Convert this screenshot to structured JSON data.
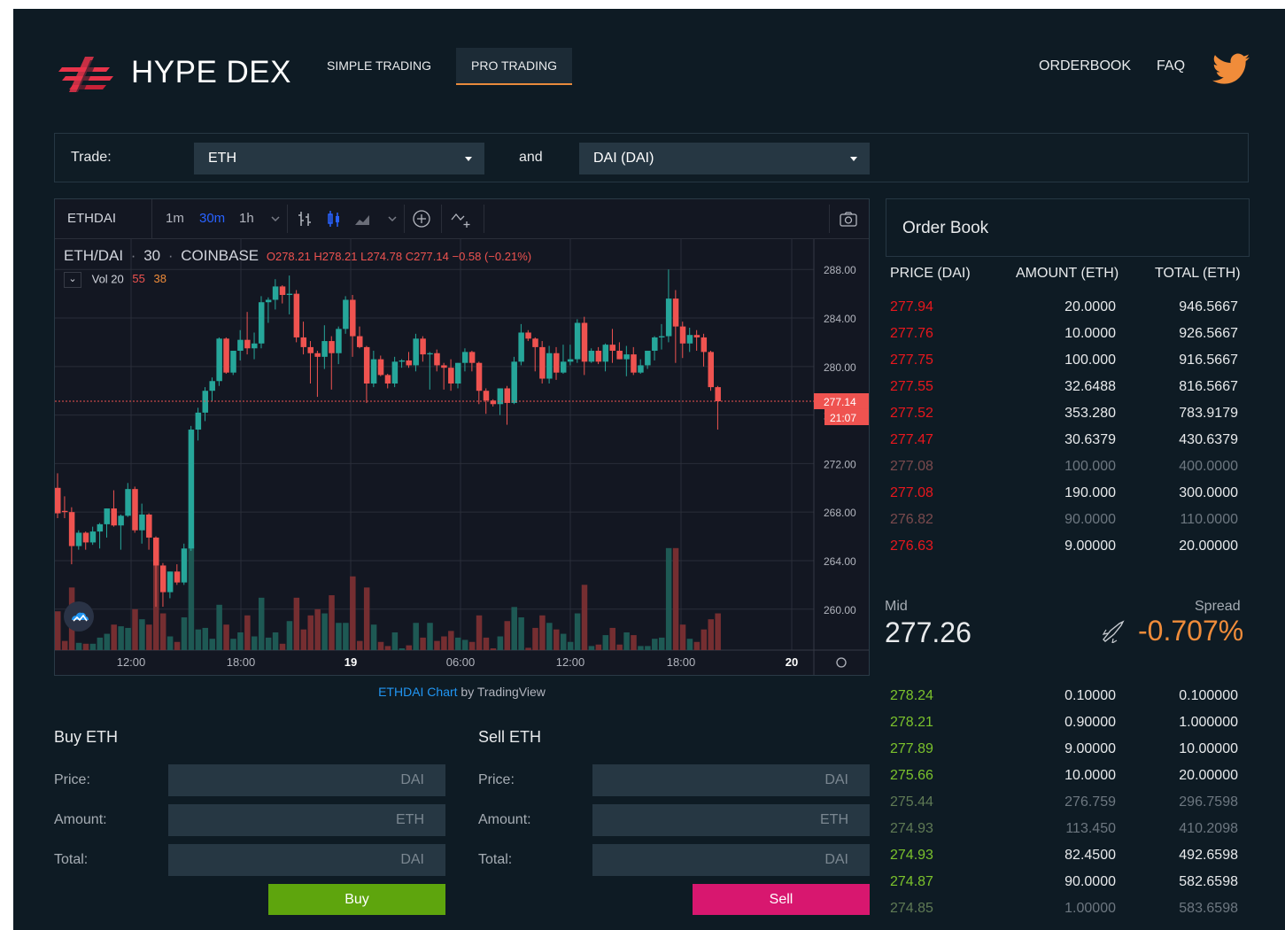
{
  "header": {
    "brand": "HYPE DEX",
    "tabs": [
      {
        "label": "SIMPLE TRADING",
        "active": false
      },
      {
        "label": "PRO TRADING",
        "active": true
      }
    ],
    "links": {
      "orderbook": "ORDERBOOK",
      "faq": "FAQ"
    },
    "accent_color": "#e8334a"
  },
  "trade_bar": {
    "label": "Trade:",
    "base_token": "ETH",
    "and_label": "and",
    "quote_token": "DAI (DAI)"
  },
  "chart": {
    "toolbar": {
      "symbol": "ETHDAI",
      "intervals": [
        "1m",
        "30m",
        "1h"
      ],
      "active_interval": "30m"
    },
    "legend": {
      "pair": "ETH/DAI",
      "interval": "30",
      "exchange": "COINBASE",
      "ohlc": "O278.21  H278.21  L274.78  C277.14  −0.58 (−0.21%)"
    },
    "volume_legend": {
      "label": "Vol 20",
      "v1": "55",
      "v2": "38"
    },
    "credit": {
      "link": "ETHDAI Chart",
      "suffix": " by TradingView"
    }
  },
  "chart_data": {
    "type": "candlestick",
    "title": "ETH/DAI",
    "y_ticks": [
      "288.00",
      "284.00",
      "280.00",
      "276.00",
      "272.00",
      "268.00",
      "264.00",
      "260.00"
    ],
    "ylim": [
      257.5,
      290.5
    ],
    "x_ticks": [
      "12:00",
      "18:00",
      "19",
      "06:00",
      "12:00",
      "18:00",
      "20"
    ],
    "current_price": "277.14",
    "countdown": "21:07",
    "up_color": "#26a69a",
    "down_color": "#ef5350",
    "candles": [
      {
        "o": 270.0,
        "h": 271.2,
        "l": 267.5,
        "c": 267.9
      },
      {
        "o": 268.1,
        "h": 269.3,
        "l": 267.5,
        "c": 268.0
      },
      {
        "o": 268.0,
        "h": 268.4,
        "l": 263.7,
        "c": 265.2
      },
      {
        "o": 265.2,
        "h": 266.5,
        "l": 264.9,
        "c": 266.3
      },
      {
        "o": 266.3,
        "h": 266.4,
        "l": 264.9,
        "c": 265.5
      },
      {
        "o": 265.5,
        "h": 266.8,
        "l": 265.3,
        "c": 266.4
      },
      {
        "o": 266.4,
        "h": 267.1,
        "l": 265.0,
        "c": 267.0
      },
      {
        "o": 267.0,
        "h": 268.3,
        "l": 265.9,
        "c": 268.3
      },
      {
        "o": 268.3,
        "h": 269.8,
        "l": 266.8,
        "c": 266.9
      },
      {
        "o": 266.9,
        "h": 267.8,
        "l": 264.9,
        "c": 267.7
      },
      {
        "o": 267.7,
        "h": 270.4,
        "l": 267.6,
        "c": 269.9
      },
      {
        "o": 269.9,
        "h": 270.1,
        "l": 266.3,
        "c": 266.5
      },
      {
        "o": 266.5,
        "h": 268.7,
        "l": 265.4,
        "c": 267.8
      },
      {
        "o": 267.8,
        "h": 267.9,
        "l": 264.9,
        "c": 265.9
      },
      {
        "o": 265.9,
        "h": 266.0,
        "l": 260.2,
        "c": 263.6
      },
      {
        "o": 263.6,
        "h": 263.8,
        "l": 260.2,
        "c": 261.4
      },
      {
        "o": 261.4,
        "h": 263.1,
        "l": 260.9,
        "c": 263.1
      },
      {
        "o": 263.1,
        "h": 263.7,
        "l": 262.0,
        "c": 262.2
      },
      {
        "o": 262.2,
        "h": 265.4,
        "l": 262.0,
        "c": 265.0
      },
      {
        "o": 265.0,
        "h": 275.1,
        "l": 264.8,
        "c": 274.8
      },
      {
        "o": 274.8,
        "h": 276.6,
        "l": 273.9,
        "c": 276.2
      },
      {
        "o": 276.2,
        "h": 278.3,
        "l": 275.5,
        "c": 278.0
      },
      {
        "o": 278.0,
        "h": 279.1,
        "l": 277.1,
        "c": 278.8
      },
      {
        "o": 278.8,
        "h": 282.4,
        "l": 278.4,
        "c": 282.3
      },
      {
        "o": 282.3,
        "h": 282.4,
        "l": 279.4,
        "c": 279.5
      },
      {
        "o": 279.5,
        "h": 281.3,
        "l": 279.3,
        "c": 281.3
      },
      {
        "o": 281.3,
        "h": 283.0,
        "l": 280.5,
        "c": 282.2
      },
      {
        "o": 282.2,
        "h": 284.5,
        "l": 281.0,
        "c": 281.5
      },
      {
        "o": 281.5,
        "h": 282.8,
        "l": 280.6,
        "c": 281.9
      },
      {
        "o": 281.9,
        "h": 285.8,
        "l": 281.5,
        "c": 285.3
      },
      {
        "o": 285.3,
        "h": 285.7,
        "l": 283.6,
        "c": 285.5
      },
      {
        "o": 285.5,
        "h": 287.2,
        "l": 284.7,
        "c": 286.6
      },
      {
        "o": 286.6,
        "h": 286.7,
        "l": 285.2,
        "c": 285.9
      },
      {
        "o": 285.9,
        "h": 287.5,
        "l": 284.3,
        "c": 286.0
      },
      {
        "o": 286.0,
        "h": 286.3,
        "l": 282.0,
        "c": 282.4
      },
      {
        "o": 282.4,
        "h": 283.7,
        "l": 281.0,
        "c": 281.6
      },
      {
        "o": 281.6,
        "h": 282.1,
        "l": 278.6,
        "c": 281.1
      },
      {
        "o": 281.1,
        "h": 281.3,
        "l": 277.5,
        "c": 280.8
      },
      {
        "o": 280.8,
        "h": 283.4,
        "l": 279.8,
        "c": 282.1
      },
      {
        "o": 282.1,
        "h": 282.5,
        "l": 278.1,
        "c": 281.1
      },
      {
        "o": 281.1,
        "h": 283.3,
        "l": 280.2,
        "c": 283.1
      },
      {
        "o": 283.1,
        "h": 285.8,
        "l": 282.7,
        "c": 285.5
      },
      {
        "o": 285.5,
        "h": 285.9,
        "l": 280.8,
        "c": 282.5
      },
      {
        "o": 282.5,
        "h": 283.3,
        "l": 281.5,
        "c": 281.6
      },
      {
        "o": 281.6,
        "h": 281.7,
        "l": 277.0,
        "c": 278.6
      },
      {
        "o": 278.6,
        "h": 281.3,
        "l": 278.3,
        "c": 280.6
      },
      {
        "o": 280.6,
        "h": 280.9,
        "l": 279.2,
        "c": 279.3
      },
      {
        "o": 279.3,
        "h": 279.4,
        "l": 278.2,
        "c": 278.6
      },
      {
        "o": 278.6,
        "h": 280.8,
        "l": 278.3,
        "c": 280.4
      },
      {
        "o": 280.4,
        "h": 280.6,
        "l": 279.9,
        "c": 280.5
      },
      {
        "o": 280.5,
        "h": 281.2,
        "l": 279.9,
        "c": 280.1
      },
      {
        "o": 280.1,
        "h": 282.7,
        "l": 279.6,
        "c": 282.3
      },
      {
        "o": 282.3,
        "h": 282.5,
        "l": 280.4,
        "c": 281.0
      },
      {
        "o": 281.0,
        "h": 281.2,
        "l": 278.1,
        "c": 281.1
      },
      {
        "o": 281.1,
        "h": 281.4,
        "l": 279.6,
        "c": 280.1
      },
      {
        "o": 280.1,
        "h": 280.3,
        "l": 278.1,
        "c": 279.9
      },
      {
        "o": 279.9,
        "h": 280.6,
        "l": 278.0,
        "c": 278.6
      },
      {
        "o": 278.6,
        "h": 280.3,
        "l": 278.2,
        "c": 280.3
      },
      {
        "o": 280.3,
        "h": 281.5,
        "l": 279.6,
        "c": 281.2
      },
      {
        "o": 281.2,
        "h": 281.3,
        "l": 279.6,
        "c": 280.3
      },
      {
        "o": 280.3,
        "h": 280.4,
        "l": 276.9,
        "c": 278.0
      },
      {
        "o": 278.0,
        "h": 278.2,
        "l": 276.1,
        "c": 277.2
      },
      {
        "o": 277.2,
        "h": 277.3,
        "l": 276.7,
        "c": 276.9
      },
      {
        "o": 276.9,
        "h": 278.2,
        "l": 276.0,
        "c": 278.2
      },
      {
        "o": 278.2,
        "h": 278.4,
        "l": 275.2,
        "c": 277.0
      },
      {
        "o": 277.0,
        "h": 280.8,
        "l": 276.9,
        "c": 280.4
      },
      {
        "o": 280.4,
        "h": 283.5,
        "l": 280.1,
        "c": 282.8
      },
      {
        "o": 282.8,
        "h": 283.0,
        "l": 282.1,
        "c": 282.3
      },
      {
        "o": 282.3,
        "h": 282.4,
        "l": 279.6,
        "c": 281.6
      },
      {
        "o": 281.6,
        "h": 282.1,
        "l": 278.6,
        "c": 279.0
      },
      {
        "o": 279.0,
        "h": 281.7,
        "l": 278.6,
        "c": 281.1
      },
      {
        "o": 281.1,
        "h": 281.6,
        "l": 278.9,
        "c": 279.5
      },
      {
        "o": 279.5,
        "h": 281.8,
        "l": 279.4,
        "c": 280.4
      },
      {
        "o": 280.4,
        "h": 281.8,
        "l": 280.1,
        "c": 280.6
      },
      {
        "o": 280.6,
        "h": 283.9,
        "l": 280.3,
        "c": 283.6
      },
      {
        "o": 283.6,
        "h": 284.1,
        "l": 279.3,
        "c": 280.4
      },
      {
        "o": 280.4,
        "h": 281.5,
        "l": 280.3,
        "c": 281.3
      },
      {
        "o": 281.3,
        "h": 281.6,
        "l": 280.2,
        "c": 280.4
      },
      {
        "o": 280.4,
        "h": 281.9,
        "l": 279.6,
        "c": 281.8
      },
      {
        "o": 281.8,
        "h": 283.1,
        "l": 280.3,
        "c": 281.3
      },
      {
        "o": 281.3,
        "h": 282.0,
        "l": 280.6,
        "c": 280.6
      },
      {
        "o": 280.6,
        "h": 281.7,
        "l": 279.2,
        "c": 281.0
      },
      {
        "o": 281.0,
        "h": 281.6,
        "l": 279.3,
        "c": 279.5
      },
      {
        "o": 279.5,
        "h": 280.6,
        "l": 279.4,
        "c": 280.1
      },
      {
        "o": 280.1,
        "h": 281.0,
        "l": 279.8,
        "c": 281.3
      },
      {
        "o": 281.3,
        "h": 282.5,
        "l": 280.5,
        "c": 282.4
      },
      {
        "o": 282.4,
        "h": 283.5,
        "l": 281.4,
        "c": 282.5
      },
      {
        "o": 282.5,
        "h": 288.0,
        "l": 282.0,
        "c": 285.6
      },
      {
        "o": 285.6,
        "h": 286.3,
        "l": 280.3,
        "c": 283.3
      },
      {
        "o": 283.3,
        "h": 283.7,
        "l": 280.7,
        "c": 281.9
      },
      {
        "o": 281.9,
        "h": 283.2,
        "l": 281.2,
        "c": 282.6
      },
      {
        "o": 282.6,
        "h": 283.0,
        "l": 281.3,
        "c": 282.4
      },
      {
        "o": 282.4,
        "h": 282.7,
        "l": 280.0,
        "c": 281.2
      },
      {
        "o": 281.2,
        "h": 281.3,
        "l": 278.0,
        "c": 278.3
      },
      {
        "o": 278.3,
        "h": 278.4,
        "l": 274.8,
        "c": 277.14
      }
    ],
    "volume_peaks_note": ""
  },
  "buy_form": {
    "title": "Buy ETH",
    "price_label": "Price:",
    "price_unit": "DAI",
    "amount_label": "Amount:",
    "amount_unit": "ETH",
    "total_label": "Total:",
    "total_unit": "DAI",
    "button": "Buy"
  },
  "sell_form": {
    "title": "Sell ETH",
    "price_label": "Price:",
    "price_unit": "DAI",
    "amount_label": "Amount:",
    "amount_unit": "ETH",
    "total_label": "Total:",
    "total_unit": "DAI",
    "button": "Sell"
  },
  "order_book": {
    "title": "Order Book",
    "columns": [
      "PRICE (DAI)",
      "AMOUNT (ETH)",
      "TOTAL (ETH)"
    ],
    "asks": [
      {
        "price": "277.94",
        "amount": "20.0000",
        "total": "946.5667",
        "dim": false
      },
      {
        "price": "277.76",
        "amount": "10.0000",
        "total": "926.5667",
        "dim": false
      },
      {
        "price": "277.75",
        "amount": "100.000",
        "total": "916.5667",
        "dim": false
      },
      {
        "price": "277.55",
        "amount": "32.6488",
        "total": "816.5667",
        "dim": false
      },
      {
        "price": "277.52",
        "amount": "353.280",
        "total": "783.9179",
        "dim": false
      },
      {
        "price": "277.47",
        "amount": "30.6379",
        "total": "430.6379",
        "dim": false
      },
      {
        "price": "277.08",
        "amount": "100.000",
        "total": "400.0000",
        "dim": true
      },
      {
        "price": "277.08",
        "amount": "190.000",
        "total": "300.0000",
        "dim": false
      },
      {
        "price": "276.82",
        "amount": "90.0000",
        "total": "110.0000",
        "dim": true
      },
      {
        "price": "276.63",
        "amount": "9.00000",
        "total": "20.00000",
        "dim": false
      }
    ],
    "mid_label": "Mid",
    "mid_value": "277.26",
    "spread_label": "Spread",
    "spread_value": "-0.707%",
    "bids": [
      {
        "price": "278.24",
        "amount": "0.10000",
        "total": "0.100000",
        "dim": false
      },
      {
        "price": "278.21",
        "amount": "0.90000",
        "total": "1.000000",
        "dim": false
      },
      {
        "price": "277.89",
        "amount": "9.00000",
        "total": "10.00000",
        "dim": false
      },
      {
        "price": "275.66",
        "amount": "10.0000",
        "total": "20.00000",
        "dim": false
      },
      {
        "price": "275.44",
        "amount": "276.759",
        "total": "296.7598",
        "dim": true
      },
      {
        "price": "274.93",
        "amount": "113.450",
        "total": "410.2098",
        "dim": true
      },
      {
        "price": "274.93",
        "amount": "82.4500",
        "total": "492.6598",
        "dim": false
      },
      {
        "price": "274.87",
        "amount": "90.0000",
        "total": "582.6598",
        "dim": false
      },
      {
        "price": "274.85",
        "amount": "1.00000",
        "total": "583.6598",
        "dim": true
      }
    ],
    "ask_color": "#e8171d",
    "bid_color": "#7bc22c"
  }
}
